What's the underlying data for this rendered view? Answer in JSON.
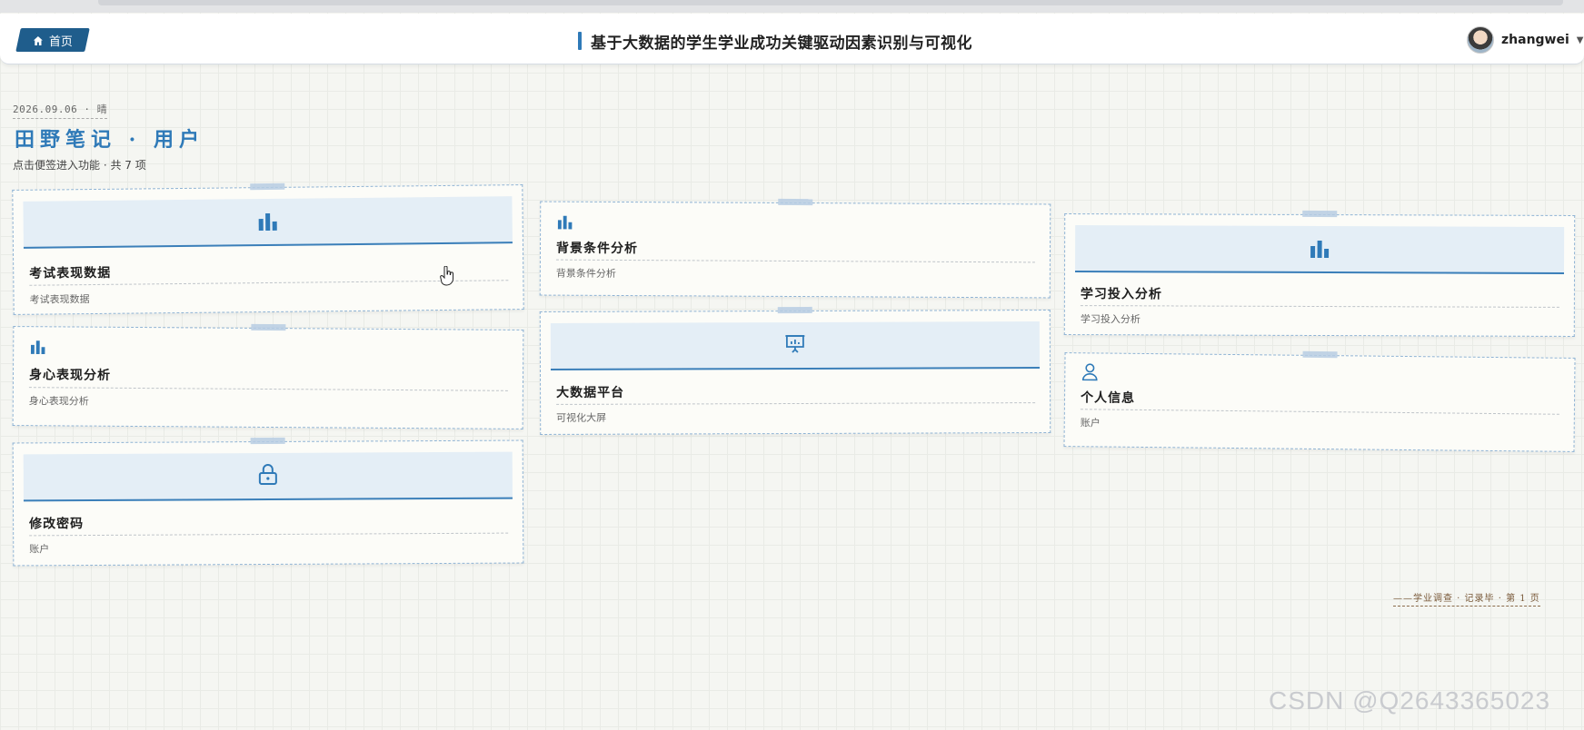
{
  "header": {
    "home_label": "首页",
    "title": "基于大数据的学生学业成功关键驱动因素识别与可视化",
    "username": "zhangwei"
  },
  "page": {
    "date": "2026.09.06 · 晴",
    "title": "田野笔记 · 用户",
    "subtitle": "点击便签进入功能 · 共 7 项"
  },
  "cards": [
    {
      "title": "考试表现数据",
      "desc": "考试表现数据",
      "icon": "bar-chart-icon"
    },
    {
      "title": "身心表现分析",
      "desc": "身心表现分析",
      "icon": "bar-chart-icon"
    },
    {
      "title": "修改密码",
      "desc": "账户",
      "icon": "lock-icon"
    },
    {
      "title": "背景条件分析",
      "desc": "背景条件分析",
      "icon": "bar-chart-icon"
    },
    {
      "title": "大数据平台",
      "desc": "可视化大屏",
      "icon": "presentation-icon"
    },
    {
      "title": "学习投入分析",
      "desc": "学习投入分析",
      "icon": "bar-chart-icon"
    },
    {
      "title": "个人信息",
      "desc": "账户",
      "icon": "user-icon"
    }
  ],
  "footer": {
    "note": "——学业调查 · 记录毕 · 第 1 页"
  },
  "watermark": "CSDN @Q2643365023",
  "colors": {
    "accent": "#2f7ab8",
    "nav": "#1f5d8c",
    "banner": "#e4eef6"
  }
}
